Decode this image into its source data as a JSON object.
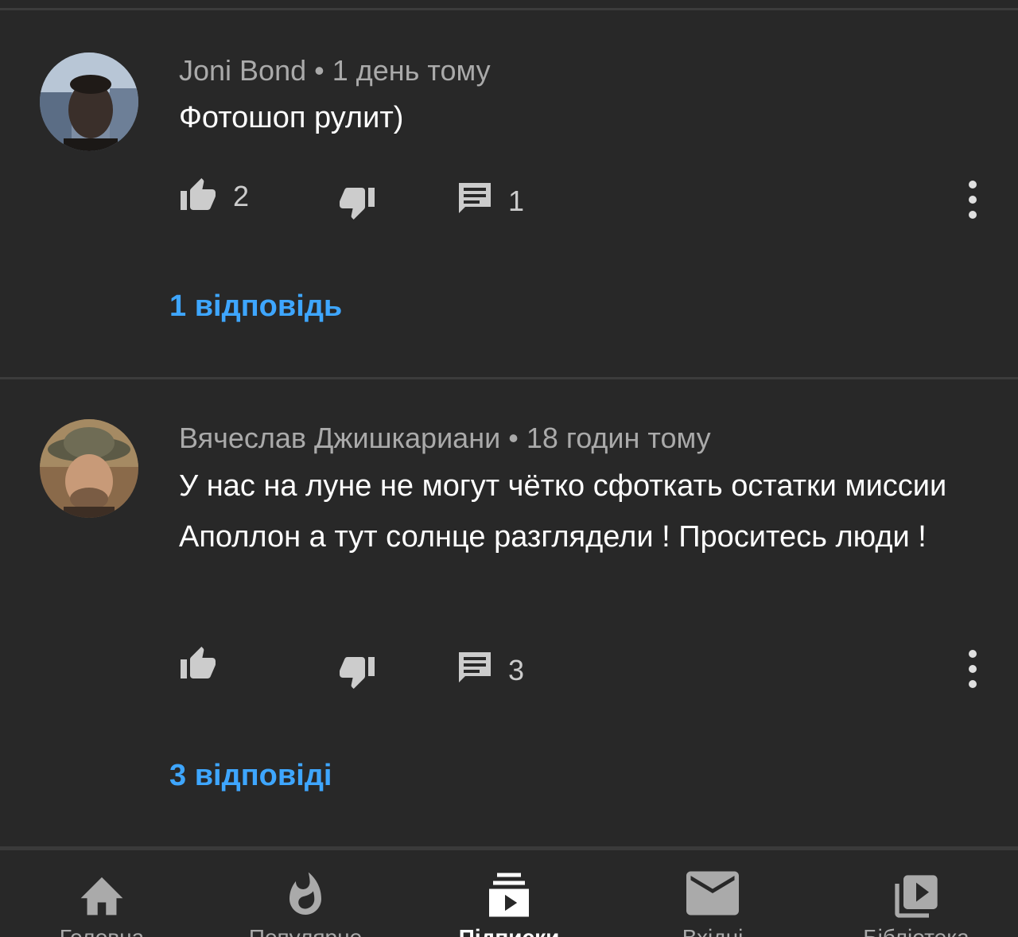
{
  "comments": [
    {
      "author": "Joni Bond",
      "separator": "•",
      "time": "1 день тому",
      "text": "Фотошоп рулит)",
      "likes": "2",
      "dislikes": "",
      "reply_count": "1",
      "replies_label": "1 відповідь"
    },
    {
      "author": "Вячеслав Джишкариани",
      "separator": "•",
      "time": "18 годин тому",
      "text": "У нас на луне не могут чётко сфоткать остатки миссии Аполлон а тут солнце разглядели ! Проситесь люди !",
      "likes": "",
      "dislikes": "",
      "reply_count": "3",
      "replies_label": "3 відповіді"
    }
  ],
  "bottom_nav": [
    {
      "label": "Головна",
      "icon": "home-icon"
    },
    {
      "label": "Популярне",
      "icon": "flame-icon"
    },
    {
      "label": "Підписки",
      "icon": "subscriptions-icon",
      "active": true
    },
    {
      "label": "Вхідні",
      "icon": "mail-icon"
    },
    {
      "label": "Бібліотека",
      "icon": "library-icon"
    }
  ],
  "colors": {
    "background": "#282828",
    "link": "#3ea6ff",
    "meta": "#aaaaaa",
    "icon": "#cccccc"
  }
}
